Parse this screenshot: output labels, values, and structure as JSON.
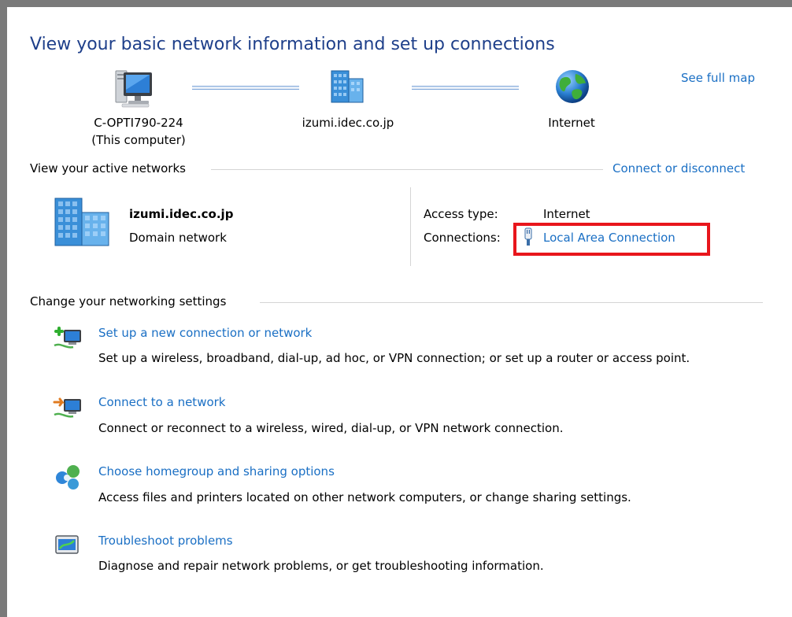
{
  "title": "View your basic network information and set up connections",
  "map": {
    "see_full_map": "See full map",
    "computer": {
      "name": "C-OPTI790-224",
      "sub": "(This computer)",
      "icon": "computer-monitor-icon"
    },
    "domain": {
      "name": "izumi.idec.co.jp",
      "icon": "domain-building-icon"
    },
    "internet": {
      "name": "Internet",
      "icon": "globe-icon"
    }
  },
  "active_networks": {
    "heading": "View your active networks",
    "connect_link": "Connect or disconnect",
    "network_name": "izumi.idec.co.jp",
    "network_type": "Domain network",
    "access_type_label": "Access type:",
    "access_type_value": "Internet",
    "connections_label": "Connections:",
    "connection_link": "Local Area Connection",
    "network_icon": "domain-building-icon"
  },
  "settings": {
    "heading": "Change your networking settings",
    "items": [
      {
        "label": "Set up a new connection or network",
        "desc": "Set up a wireless, broadband, dial-up, ad hoc, or VPN connection; or set up a router or access point.",
        "icon": "new-connection-icon"
      },
      {
        "label": "Connect to a network",
        "desc": "Connect or reconnect to a wireless, wired, dial-up, or VPN network connection.",
        "icon": "connect-network-icon"
      },
      {
        "label": "Choose homegroup and sharing options",
        "desc": "Access files and printers located on other network computers, or change sharing settings.",
        "icon": "homegroup-icon"
      },
      {
        "label": "Troubleshoot problems",
        "desc": "Diagnose and repair network problems, or get troubleshooting information.",
        "icon": "troubleshoot-icon"
      }
    ]
  },
  "colors": {
    "title": "#1e3f8a",
    "link": "#1a6fc4",
    "highlight": "#e8161c",
    "frame": "#7a7a7a"
  }
}
